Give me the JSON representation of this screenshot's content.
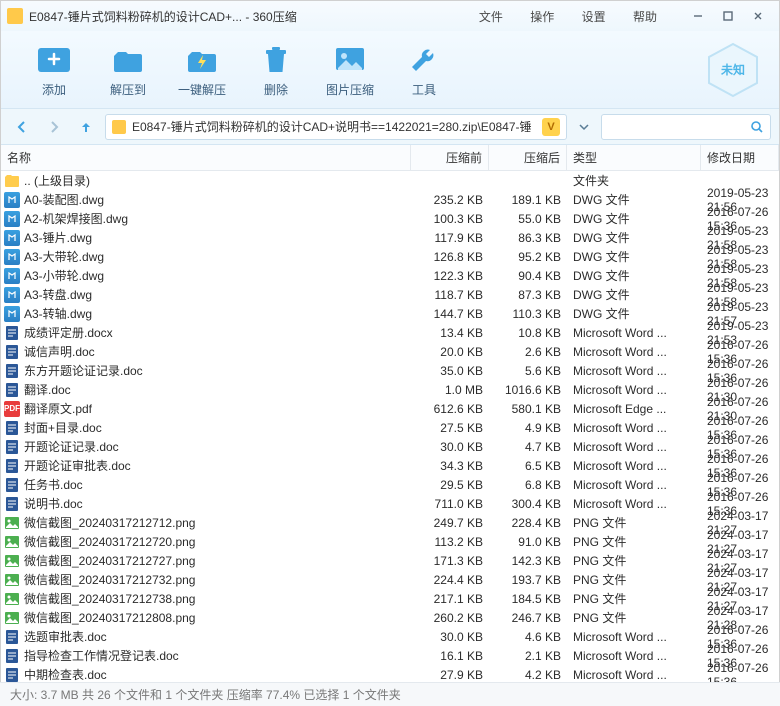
{
  "titlebar": {
    "title": "E0847-锤片式饲料粉碎机的设计CAD+... - 360压缩"
  },
  "menubar": {
    "file": "文件",
    "operate": "操作",
    "settings": "设置",
    "help": "帮助"
  },
  "toolbar": {
    "add": "添加",
    "extract_to": "解压到",
    "one_click": "一键解压",
    "delete": "删除",
    "image_compress": "图片压缩",
    "tools": "工具"
  },
  "badge": {
    "label": "未知"
  },
  "path": {
    "text": "E0847-锤片式饲料粉碎机的设计CAD+说明书==1422021=280.zip\\E0847-锤",
    "vip": "V"
  },
  "columns": {
    "name": "名称",
    "before": "压缩前",
    "after": "压缩后",
    "type": "类型",
    "date": "修改日期"
  },
  "parent": {
    "label": ".. (上级目录)",
    "type": "文件夹"
  },
  "files": [
    {
      "ic": "dwg",
      "name": "A0-装配图.dwg",
      "b": "235.2 KB",
      "a": "189.1 KB",
      "t": "DWG 文件",
      "d": "2019-05-23 21:56"
    },
    {
      "ic": "dwg",
      "name": "A2-机架焊接图.dwg",
      "b": "100.3 KB",
      "a": "55.0 KB",
      "t": "DWG 文件",
      "d": "2016-07-26 15:36"
    },
    {
      "ic": "dwg",
      "name": "A3-锤片.dwg",
      "b": "117.9 KB",
      "a": "86.3 KB",
      "t": "DWG 文件",
      "d": "2019-05-23 21:58"
    },
    {
      "ic": "dwg",
      "name": "A3-大带轮.dwg",
      "b": "126.8 KB",
      "a": "95.2 KB",
      "t": "DWG 文件",
      "d": "2019-05-23 21:58"
    },
    {
      "ic": "dwg",
      "name": "A3-小带轮.dwg",
      "b": "122.3 KB",
      "a": "90.4 KB",
      "t": "DWG 文件",
      "d": "2019-05-23 21:58"
    },
    {
      "ic": "dwg",
      "name": "A3-转盘.dwg",
      "b": "118.7 KB",
      "a": "87.3 KB",
      "t": "DWG 文件",
      "d": "2019-05-23 21:58"
    },
    {
      "ic": "dwg",
      "name": "A3-转轴.dwg",
      "b": "144.7 KB",
      "a": "110.3 KB",
      "t": "DWG 文件",
      "d": "2019-05-23 21:57"
    },
    {
      "ic": "doc",
      "name": "成绩评定册.docx",
      "b": "13.4 KB",
      "a": "10.8 KB",
      "t": "Microsoft Word ...",
      "d": "2019-05-23 21:53"
    },
    {
      "ic": "doc",
      "name": "诚信声明.doc",
      "b": "20.0 KB",
      "a": "2.6 KB",
      "t": "Microsoft Word ...",
      "d": "2016-07-26 15:36"
    },
    {
      "ic": "doc",
      "name": "东方开题论证记录.doc",
      "b": "35.0 KB",
      "a": "5.6 KB",
      "t": "Microsoft Word ...",
      "d": "2016-07-26 15:36"
    },
    {
      "ic": "doc",
      "name": "翻译.doc",
      "b": "1.0 MB",
      "a": "1016.6 KB",
      "t": "Microsoft Word ...",
      "d": "2016-07-26 21:30"
    },
    {
      "ic": "pdf",
      "name": "翻译原文.pdf",
      "b": "612.6 KB",
      "a": "580.1 KB",
      "t": "Microsoft Edge ...",
      "d": "2016-07-26 21:30"
    },
    {
      "ic": "doc",
      "name": "封面+目录.doc",
      "b": "27.5 KB",
      "a": "4.9 KB",
      "t": "Microsoft Word ...",
      "d": "2016-07-26 15:36"
    },
    {
      "ic": "doc",
      "name": "开题论证记录.doc",
      "b": "30.0 KB",
      "a": "4.7 KB",
      "t": "Microsoft Word ...",
      "d": "2016-07-26 15:36"
    },
    {
      "ic": "doc",
      "name": "开题论证审批表.doc",
      "b": "34.3 KB",
      "a": "6.5 KB",
      "t": "Microsoft Word ...",
      "d": "2016-07-26 15:36"
    },
    {
      "ic": "doc",
      "name": "任务书.doc",
      "b": "29.5 KB",
      "a": "6.8 KB",
      "t": "Microsoft Word ...",
      "d": "2016-07-26 15:36"
    },
    {
      "ic": "doc",
      "name": "说明书.doc",
      "b": "711.0 KB",
      "a": "300.4 KB",
      "t": "Microsoft Word ...",
      "d": "2016-07-26 15:36"
    },
    {
      "ic": "png",
      "name": "微信截图_20240317212712.png",
      "b": "249.7 KB",
      "a": "228.4 KB",
      "t": "PNG 文件",
      "d": "2024-03-17 21:27"
    },
    {
      "ic": "png",
      "name": "微信截图_20240317212720.png",
      "b": "113.2 KB",
      "a": "91.0 KB",
      "t": "PNG 文件",
      "d": "2024-03-17 21:27"
    },
    {
      "ic": "png",
      "name": "微信截图_20240317212727.png",
      "b": "171.3 KB",
      "a": "142.3 KB",
      "t": "PNG 文件",
      "d": "2024-03-17 21:27"
    },
    {
      "ic": "png",
      "name": "微信截图_20240317212732.png",
      "b": "224.4 KB",
      "a": "193.7 KB",
      "t": "PNG 文件",
      "d": "2024-03-17 21:27"
    },
    {
      "ic": "png",
      "name": "微信截图_20240317212738.png",
      "b": "217.1 KB",
      "a": "184.5 KB",
      "t": "PNG 文件",
      "d": "2024-03-17 21:27"
    },
    {
      "ic": "png",
      "name": "微信截图_20240317212808.png",
      "b": "260.2 KB",
      "a": "246.7 KB",
      "t": "PNG 文件",
      "d": "2024-03-17 21:28"
    },
    {
      "ic": "doc",
      "name": "选题审批表.doc",
      "b": "30.0 KB",
      "a": "4.6 KB",
      "t": "Microsoft Word ...",
      "d": "2016-07-26 15:36"
    },
    {
      "ic": "doc",
      "name": "指导检查工作情况登记表.doc",
      "b": "16.1 KB",
      "a": "2.1 KB",
      "t": "Microsoft Word ...",
      "d": "2016-07-26 15:36"
    },
    {
      "ic": "doc",
      "name": "中期检查表.doc",
      "b": "27.9 KB",
      "a": "4.2 KB",
      "t": "Microsoft Word ...",
      "d": "2016-07-26 15:36"
    }
  ],
  "status": {
    "text": "大小: 3.7 MB 共 26 个文件和 1 个文件夹 压缩率 77.4% 已选择 1 个文件夹"
  }
}
